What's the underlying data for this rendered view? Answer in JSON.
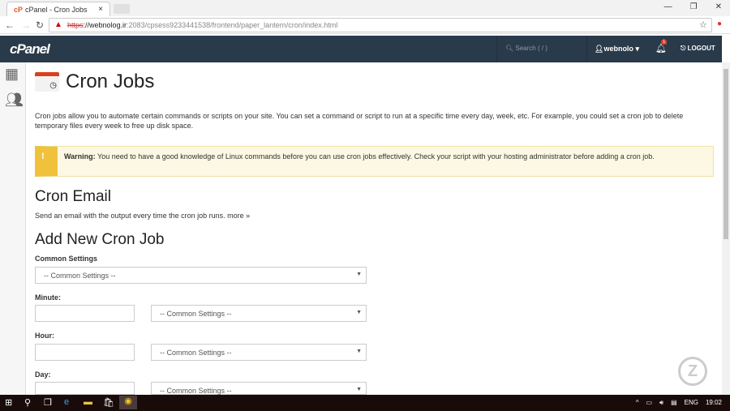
{
  "browser": {
    "tab_title": "cPanel - Cron Jobs",
    "url_scheme": "https",
    "url_host": "://webnolog.ir",
    "url_rest": ":2083/cpsess9233441538/frontend/paper_lantern/cron/index.html"
  },
  "header": {
    "logo": "cPanel",
    "search_placeholder": "Search ( / )",
    "user": "webnolo",
    "notifications": "1",
    "logout": "LOGOUT"
  },
  "page": {
    "title": "Cron Jobs",
    "description": "Cron jobs allow you to automate certain commands or scripts on your site. You can set a command or script to run at a specific time every day, week, etc. For example, you could set a cron job to delete temporary files every week to free up disk space.",
    "warning_label": "Warning:",
    "warning_text": "You need to have a good knowledge of Linux commands before you can use cron jobs effectively. Check your script with your hosting administrator before adding a cron job.",
    "cron_email_title": "Cron Email",
    "cron_email_text": "Send an email with the output every time the cron job runs.",
    "more_link": "more »",
    "add_title": "Add New Cron Job",
    "common_settings_label": "Common Settings",
    "common_settings_value": "-- Common Settings --",
    "minute_label": "Minute:",
    "hour_label": "Hour:",
    "day_label": "Day:"
  },
  "taskbar": {
    "lang": "ENG",
    "time": "19:02"
  }
}
